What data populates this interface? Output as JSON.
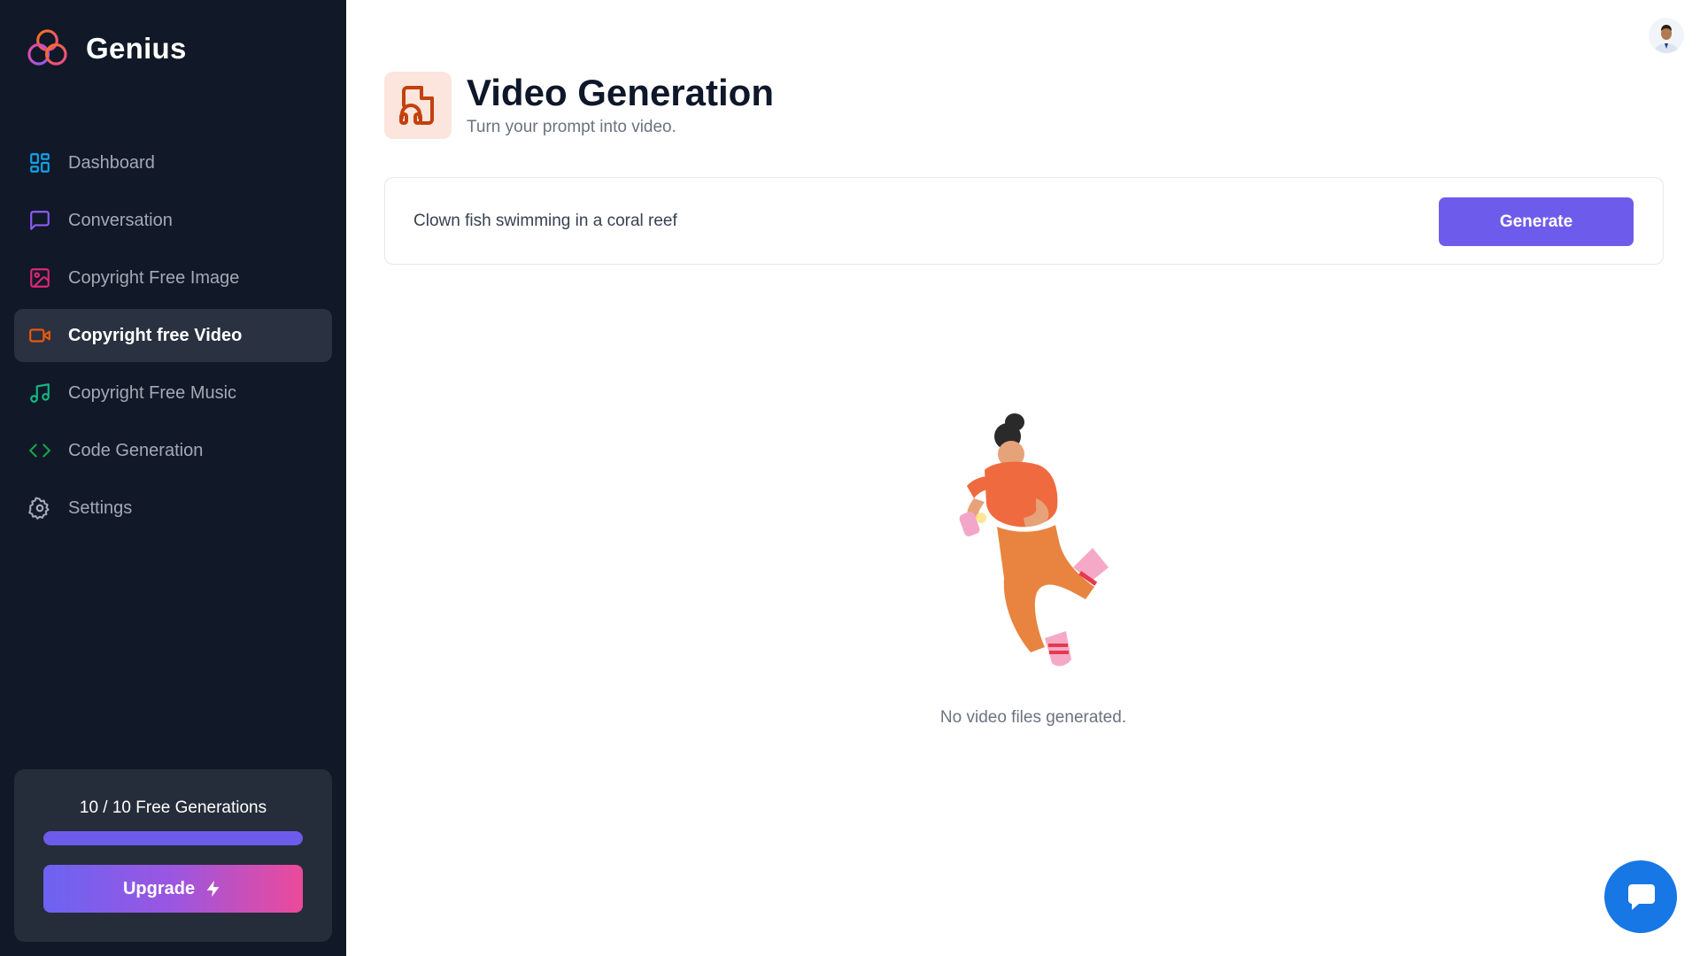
{
  "app": {
    "name": "Genius"
  },
  "sidebar": {
    "items": [
      {
        "label": "Dashboard",
        "icon": "dashboard-icon",
        "color": "#0ea5e9",
        "active": false
      },
      {
        "label": "Conversation",
        "icon": "chat-icon",
        "color": "#8b5cf6",
        "active": false
      },
      {
        "label": "Copyright Free Image",
        "icon": "image-icon",
        "color": "#db2777",
        "active": false
      },
      {
        "label": "Copyright free Video",
        "icon": "video-icon",
        "color": "#ea580c",
        "active": true
      },
      {
        "label": "Copyright Free Music",
        "icon": "music-icon",
        "color": "#10b981",
        "active": false
      },
      {
        "label": "Code Generation",
        "icon": "code-icon",
        "color": "#16a34a",
        "active": false
      },
      {
        "label": "Settings",
        "icon": "gear-icon",
        "color": "#a3a9b6",
        "active": false
      }
    ]
  },
  "quota": {
    "text": "10 / 10 Free Generations",
    "used": 10,
    "limit": 10,
    "upgrade_label": "Upgrade"
  },
  "page": {
    "title": "Video Generation",
    "subtitle": "Turn your prompt into video.",
    "icon": "music-file-icon",
    "accent": "#c2410c"
  },
  "prompt": {
    "value": "Clown fish swimming in a coral reef",
    "generate_label": "Generate"
  },
  "empty_state": {
    "message": "No video files generated."
  },
  "colors": {
    "sidebar_bg": "#111827",
    "primary": "#6d5ceb",
    "chat_button": "#1677e5"
  }
}
